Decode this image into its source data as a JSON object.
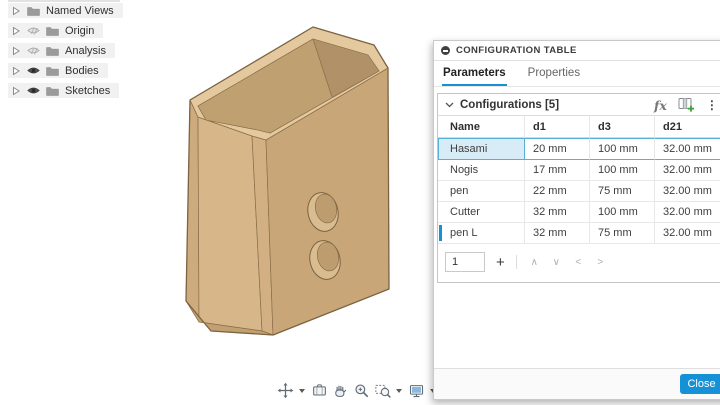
{
  "browser": {
    "items": [
      {
        "label": "Named Views",
        "eye": "none"
      },
      {
        "label": "Origin",
        "eye": "off"
      },
      {
        "label": "Analysis",
        "eye": "off"
      },
      {
        "label": "Bodies",
        "eye": "on"
      },
      {
        "label": "Sketches",
        "eye": "on"
      }
    ]
  },
  "model": {
    "description": "tan open-top box with chamfered corners and two circular holes on front face",
    "colors": {
      "left_chamfer": "#CDAB7E",
      "front_left": "#D7B78A",
      "front_chamfer": "#D2B084",
      "front_right": "#C8A678",
      "rim": "#E4C99E",
      "interior": "#BFA070",
      "interior_dark": "#B09168",
      "bottom_wedge": "#C2A072",
      "hole_ring": "#D9BC90",
      "hole_inner": "#BD9D6F",
      "outline": "#7C6342"
    }
  },
  "toolbar": {
    "icons": [
      "pan",
      "fit",
      "hand",
      "zoom",
      "zoom-window",
      "display-settings",
      "grid-snaps"
    ]
  },
  "panel": {
    "title": "CONFIGURATION TABLE",
    "tabs": [
      {
        "label": "Parameters",
        "active": true
      },
      {
        "label": "Properties",
        "active": false
      }
    ],
    "section": {
      "title": "Configurations [5]"
    },
    "tools": {
      "fx_label": "fx",
      "menu_glyph": "⋮"
    },
    "table": {
      "columns": [
        "Name",
        "d1",
        "d3",
        "d21"
      ],
      "rows": [
        {
          "name": "Hasami",
          "d1": "20 mm",
          "d3": "100 mm",
          "d21": "32.00 mm",
          "state": "selected"
        },
        {
          "name": "Nogis",
          "d1": "17 mm",
          "d3": "100 mm",
          "d21": "32.00 mm",
          "state": ""
        },
        {
          "name": "pen",
          "d1": "22 mm",
          "d3": "75 mm",
          "d21": "32.00 mm",
          "state": ""
        },
        {
          "name": "Cutter",
          "d1": "32 mm",
          "d3": "100 mm",
          "d21": "32.00 mm",
          "state": ""
        },
        {
          "name": "pen L",
          "d1": "32 mm",
          "d3": "75 mm",
          "d21": "32.00 mm",
          "state": "active"
        }
      ]
    },
    "pager": {
      "page": "1",
      "add": "+",
      "up": "∧",
      "down": "∨",
      "prev": "<",
      "next": ">"
    },
    "close_label": "Close"
  },
  "colors": {
    "accent": "#1791D6",
    "selection_bg": "#D8ECF7",
    "selection_border": "#58AFD8"
  }
}
